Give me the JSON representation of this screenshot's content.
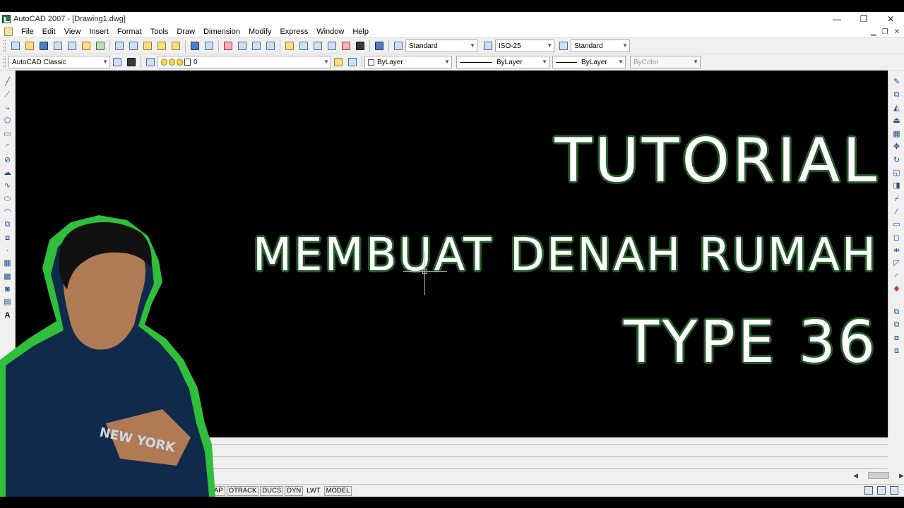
{
  "window": {
    "title": "AutoCAD 2007 - [Drawing1.dwg]",
    "controls": [
      "—",
      "❐",
      "✕"
    ]
  },
  "menu": [
    "File",
    "Edit",
    "View",
    "Insert",
    "Format",
    "Tools",
    "Draw",
    "Dimension",
    "Modify",
    "Express",
    "Window",
    "Help"
  ],
  "styles_toolbar": {
    "text_style": "Standard",
    "dim_style": "ISO-25",
    "table_style": "Standard"
  },
  "workspace_toolbar": {
    "workspace": "AutoCAD Classic",
    "layer": "0",
    "color": "ByLayer",
    "linetype": "ByLayer",
    "lineweight": "ByLayer",
    "plot_style": "ByColor"
  },
  "overlay": {
    "line1": "TUTORIAL",
    "line2": "MEMBUAT DENAH RUMAH",
    "line3": "TYPE 36"
  },
  "statusbar": {
    "buttons": [
      "AP",
      "OTRACK",
      "DUCS",
      "DYN",
      "LWT",
      "MODEL"
    ]
  },
  "colors": {
    "canvas": "#000000",
    "title_outline": "#245c2a",
    "presenter_glow": "#2fbf3a"
  }
}
